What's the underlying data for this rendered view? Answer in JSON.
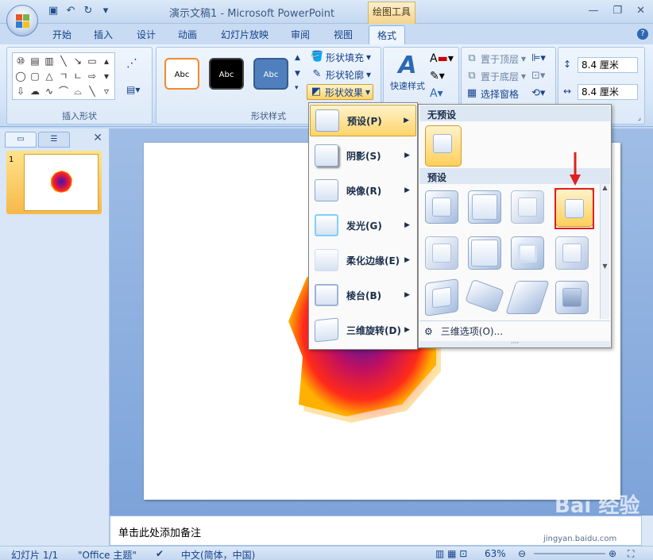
{
  "window": {
    "title": "演示文稿1 - Microsoft PowerPoint",
    "context_tab": "绘图工具"
  },
  "tabs": [
    {
      "label": "开始"
    },
    {
      "label": "插入"
    },
    {
      "label": "设计"
    },
    {
      "label": "动画"
    },
    {
      "label": "幻灯片放映"
    },
    {
      "label": "审阅"
    },
    {
      "label": "视图"
    },
    {
      "label": "格式",
      "active": true
    }
  ],
  "ribbon": {
    "insert_shapes_label": "插入形状",
    "shape_styles_label": "形状样式",
    "style_swatch_text": "Abc",
    "shape_fill": "形状填充",
    "shape_outline": "形状轮廓",
    "shape_effects": "形状效果",
    "quick_styles": "快速样式",
    "bring_to_front": "置于顶层",
    "send_to_back": "置于底层",
    "selection_pane": "选择窗格",
    "height_value": "8.4 厘米",
    "width_value": "8.4 厘米"
  },
  "slide_panel": {
    "slide_number": "1"
  },
  "effects_menu": [
    {
      "label": "预设(P)",
      "highlighted": true
    },
    {
      "label": "阴影(S)"
    },
    {
      "label": "映像(R)"
    },
    {
      "label": "发光(G)"
    },
    {
      "label": "柔化边缘(E)"
    },
    {
      "label": "棱台(B)"
    },
    {
      "label": "三维旋转(D)"
    }
  ],
  "preset_gallery": {
    "no_preset_header": "无预设",
    "preset_header": "预设",
    "footer_option": "三维选项(O)...",
    "selected_index": 3
  },
  "notes": {
    "placeholder": "单击此处添加备注"
  },
  "status": {
    "slide_info": "幻灯片 1/1",
    "theme": "\"Office 主题\"",
    "language": "中文(简体，中国)",
    "zoom": "63%"
  },
  "watermark": {
    "text": "Bai 经验",
    "url": "jingyan.baidu.com"
  },
  "colors": {
    "accent": "#15428b",
    "highlight": "#ffd46a",
    "annotation_red": "#e02020"
  }
}
